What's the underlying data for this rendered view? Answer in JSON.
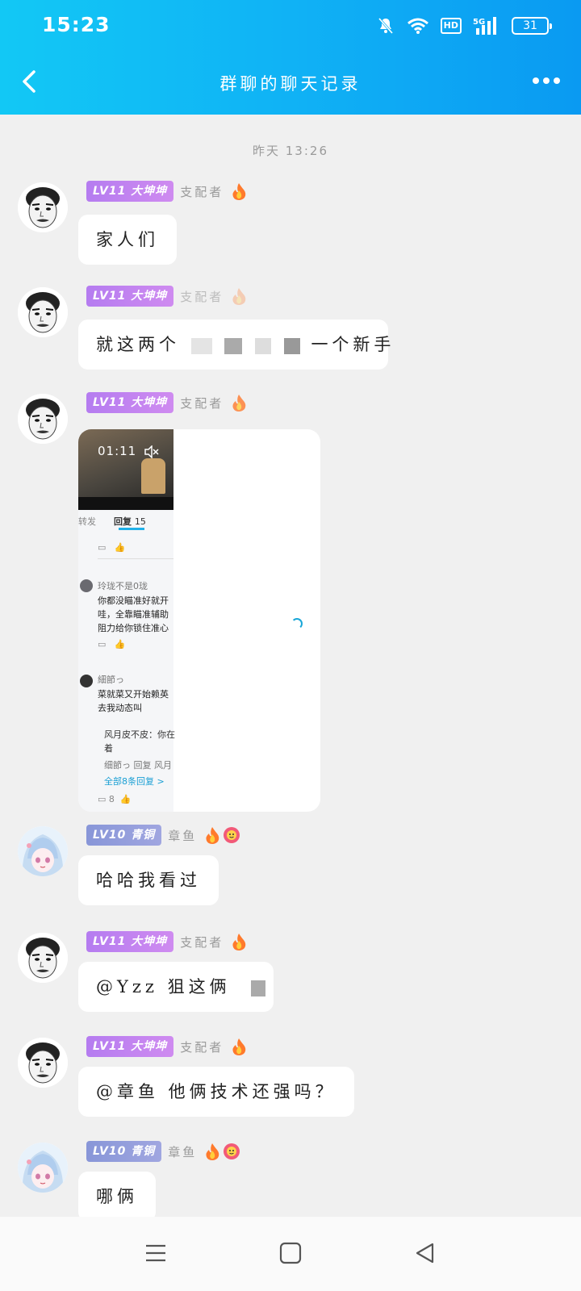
{
  "status_bar": {
    "time": "15:23",
    "battery": "31",
    "network": "5G",
    "hd": "HD",
    "icons": [
      "mute-bell-icon",
      "wifi-icon",
      "hd-icon",
      "5g-signal-icon",
      "battery-icon"
    ]
  },
  "header": {
    "title": "群聊的聊天记录",
    "back_icon": "chevron-left-icon",
    "more_icon": "more-dots-icon"
  },
  "time_separator": "昨天 13:26",
  "messages": [
    {
      "level": "LV11 大坤坤",
      "sender": "支配者",
      "text": "家人们"
    },
    {
      "level": "LV11 大坤坤",
      "sender": "支配者",
      "text_visible_start": "就这两个",
      "text_visible_end": "一个新手"
    },
    {
      "level": "LV11 大坤坤",
      "sender": "支配者",
      "media": {
        "video_time": "01:11",
        "tab_forward": "转发",
        "tab_replies": "回复",
        "replies_count": "15",
        "comments": [
          {
            "name": "玲珑不是0珑",
            "text": "你都没瞄准好就开\n哇，全靠瞄准辅助\n阻力给你锁住准心"
          },
          {
            "name": "細節っ",
            "text": "菜就菜又开始赖英\n去我动态叫"
          }
        ],
        "reply_preview": "风月皮不皮：你在\n着",
        "reply_line": "细節っ 回复 风月",
        "view_all": "全部8条回复 >",
        "like_count": "8"
      }
    },
    {
      "level": "LV10 青铜",
      "sender": "章鱼",
      "text": "哈哈我看过"
    },
    {
      "level": "LV11 大坤坤",
      "sender": "支配者",
      "text": "@Yzz 狙这俩"
    },
    {
      "level": "LV11 大坤坤",
      "sender": "支配者",
      "text": "@章鱼 他俩技术还强吗？"
    },
    {
      "level": "LV10 青铜",
      "sender": "章鱼",
      "text": "哪俩"
    }
  ],
  "nav_bar": {
    "icons": [
      "menu-icon",
      "home-square-icon",
      "back-triangle-icon"
    ]
  }
}
